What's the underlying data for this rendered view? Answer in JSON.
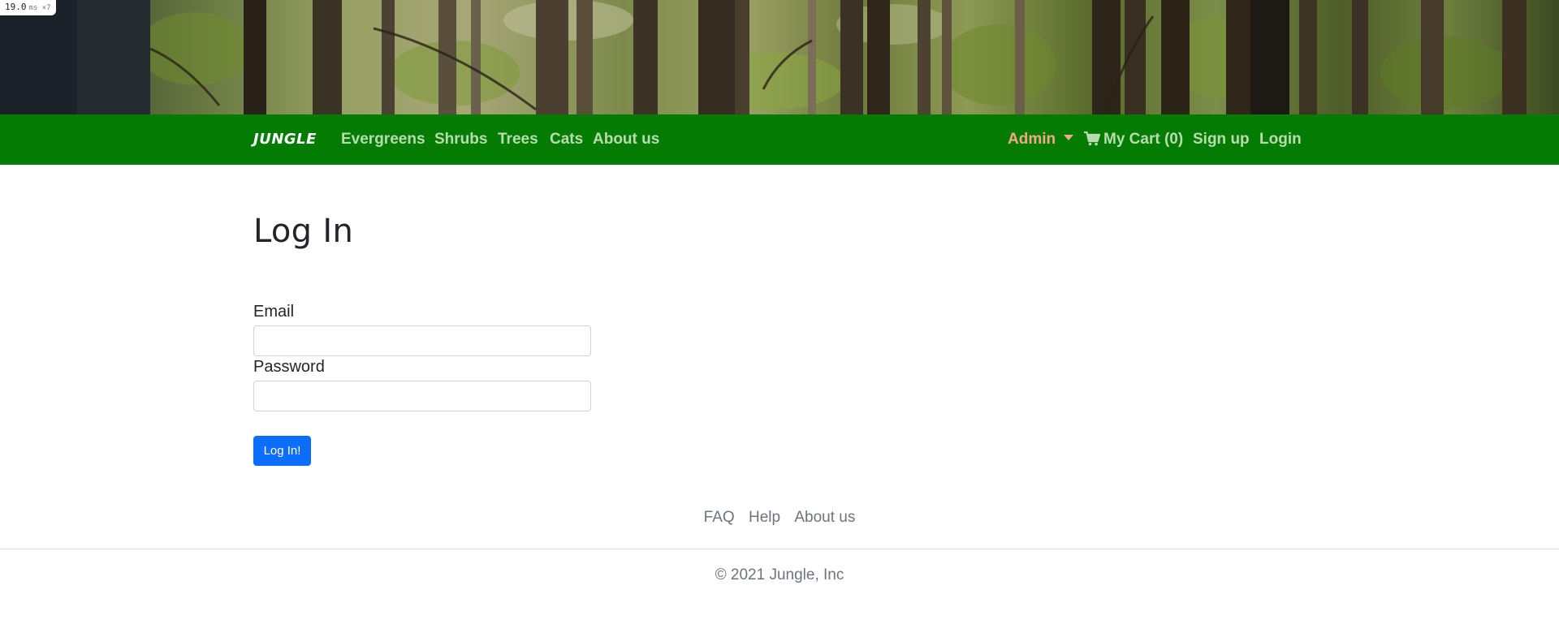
{
  "perf": {
    "value": "19.0",
    "unit": "ms ×7"
  },
  "brand": "JUNGLE",
  "nav": {
    "left_links": [
      {
        "label": "Evergreens"
      },
      {
        "label": "Shrubs"
      },
      {
        "label": "Trees"
      },
      {
        "label": "Cats"
      },
      {
        "label": "About us"
      }
    ],
    "admin_label": "Admin",
    "cart_label": "My Cart (0)",
    "signup_label": "Sign up",
    "login_label": "Login"
  },
  "page": {
    "title": "Log In",
    "email_label": "Email",
    "email_value": "",
    "password_label": "Password",
    "password_value": "",
    "submit_label": "Log In!"
  },
  "footer": {
    "links": [
      {
        "label": "FAQ"
      },
      {
        "label": "Help"
      },
      {
        "label": "About us"
      }
    ],
    "copyright": "© 2021 Jungle, Inc"
  },
  "colors": {
    "navbar": "#047c04",
    "nav_link": "#b9dcae",
    "admin_link": "#f4a889",
    "primary_button": "#0d6efd"
  }
}
